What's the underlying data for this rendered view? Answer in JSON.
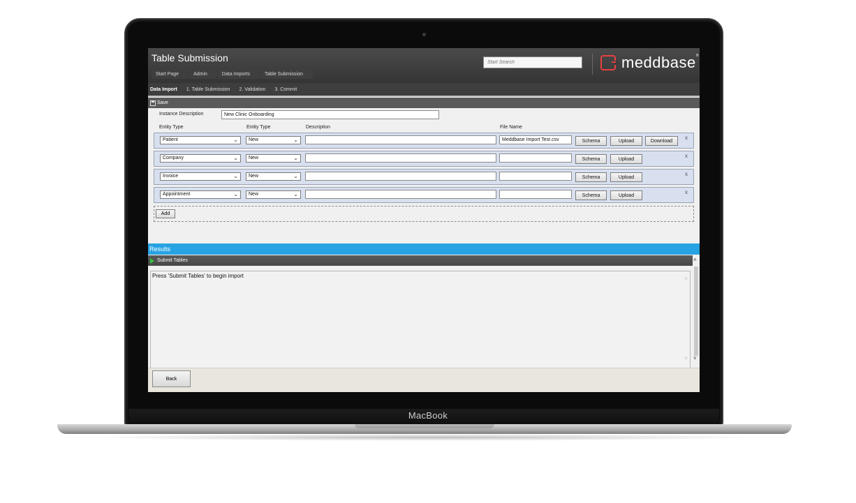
{
  "device": {
    "brand": "MacBook"
  },
  "header": {
    "title": "Table Submission",
    "breadcrumbs": [
      "Start Page",
      "Admin",
      "Data Imports",
      "Table Submission"
    ],
    "search_placeholder": "Start Search",
    "logo_text": "meddbase",
    "logo_mark": "®"
  },
  "steps": [
    "Data Import",
    "1. Table Submission",
    "2. Validation",
    "3. Commit"
  ],
  "toolbar": {
    "save_label": "Save"
  },
  "form": {
    "instance_description_label": "Instance Description",
    "instance_description_value": "New Clinic Onboarding",
    "columns": {
      "entity_type_1": "Entity Type",
      "entity_type_2": "Entity Type",
      "description": "Description",
      "file_name": "File Name"
    },
    "rows": [
      {
        "entity": "Patient",
        "type": "New",
        "description": "",
        "file": "Meddbase Import Test.csv",
        "has_download": true
      },
      {
        "entity": "Company",
        "type": "New",
        "description": "",
        "file": "",
        "has_download": false
      },
      {
        "entity": "Invoice",
        "type": "New",
        "description": "",
        "file": "",
        "has_download": false
      },
      {
        "entity": "Appointment",
        "type": "New",
        "description": "",
        "file": "",
        "has_download": false
      }
    ],
    "schema_label": "Schema",
    "upload_label": "Upload",
    "download_label": "Download",
    "remove_label": "x",
    "add_label": "Add"
  },
  "results": {
    "title": "Results",
    "submit_label": "Submit Tables",
    "message": "Press 'Submit Tables' to begin import"
  },
  "footer": {
    "back_label": "Back"
  },
  "colors": {
    "accent": "#27a3e3",
    "brand": "#e8403f",
    "row_bg": "#d8e0ef"
  }
}
